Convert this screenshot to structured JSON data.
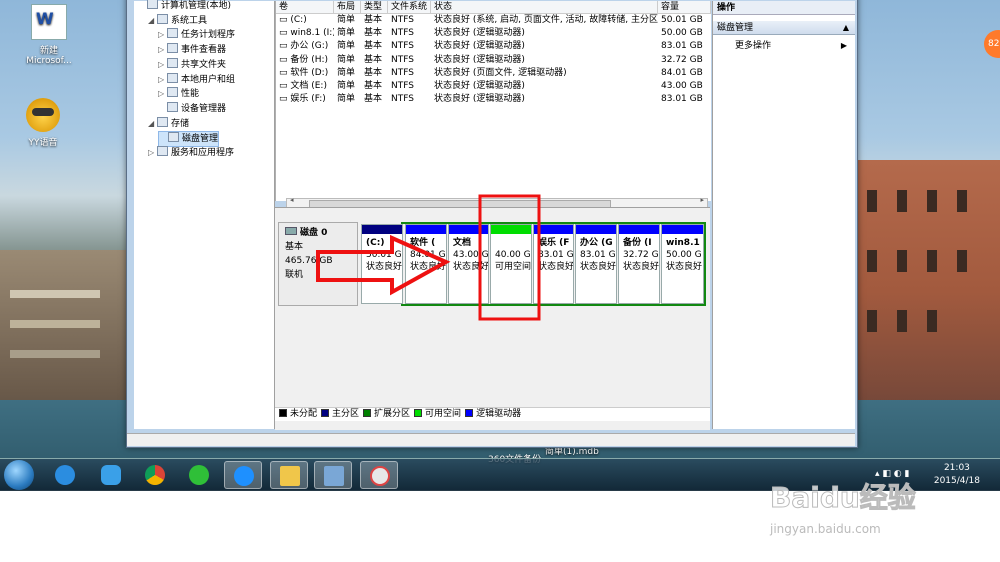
{
  "desktop": {
    "icons": [
      {
        "label": "新建\nMicrosof...",
        "icon": "word-document-icon"
      },
      {
        "label": "YY语音",
        "icon": "yy-voice-icon"
      }
    ],
    "badge": "82"
  },
  "tree": {
    "items": [
      {
        "label": "计算机管理(本地)",
        "level": 0,
        "expander": ""
      },
      {
        "label": "系统工具",
        "level": 1,
        "expander": "◢"
      },
      {
        "label": "任务计划程序",
        "level": 2,
        "expander": "▷"
      },
      {
        "label": "事件查看器",
        "level": 2,
        "expander": "▷"
      },
      {
        "label": "共享文件夹",
        "level": 2,
        "expander": "▷"
      },
      {
        "label": "本地用户和组",
        "level": 2,
        "expander": "▷"
      },
      {
        "label": "性能",
        "level": 2,
        "expander": "▷"
      },
      {
        "label": "设备管理器",
        "level": 2,
        "expander": ""
      },
      {
        "label": "存储",
        "level": 1,
        "expander": "◢"
      },
      {
        "label": "磁盘管理",
        "level": 2,
        "expander": "",
        "selected": true
      },
      {
        "label": "服务和应用程序",
        "level": 1,
        "expander": "▷"
      }
    ]
  },
  "volumes": {
    "headers": [
      "卷",
      "布局",
      "类型",
      "文件系统",
      "状态",
      "容量"
    ],
    "rows": [
      [
        "(C:)",
        "简单",
        "基本",
        "NTFS",
        "状态良好 (系统, 启动, 页面文件, 活动, 故障转储, 主分区)",
        "50.01 GB"
      ],
      [
        "win8.1 (I:)",
        "简单",
        "基本",
        "NTFS",
        "状态良好 (逻辑驱动器)",
        "50.00 GB"
      ],
      [
        "办公 (G:)",
        "简单",
        "基本",
        "NTFS",
        "状态良好 (逻辑驱动器)",
        "83.01 GB"
      ],
      [
        "备份 (H:)",
        "简单",
        "基本",
        "NTFS",
        "状态良好 (逻辑驱动器)",
        "32.72 GB"
      ],
      [
        "软件 (D:)",
        "简单",
        "基本",
        "NTFS",
        "状态良好 (页面文件, 逻辑驱动器)",
        "84.01 GB"
      ],
      [
        "文档 (E:)",
        "简单",
        "基本",
        "NTFS",
        "状态良好 (逻辑驱动器)",
        "43.00 GB"
      ],
      [
        "娱乐 (F:)",
        "简单",
        "基本",
        "NTFS",
        "状态良好 (逻辑驱动器)",
        "83.01 GB"
      ]
    ]
  },
  "disk": {
    "name": "磁盘 0",
    "type": "基本",
    "size": "465.76 GB",
    "status": "联机",
    "partitions": [
      {
        "name": "(C:)",
        "size": "50.01 G",
        "status": "状态良好",
        "bar": "#000080"
      },
      {
        "name": "软件 (",
        "size": "84.01 G",
        "status": "状态良好",
        "bar": "#0000ff"
      },
      {
        "name": "文档",
        "size": "43.00 G",
        "status": "状态良好",
        "bar": "#0000ff"
      },
      {
        "name": "",
        "size": "40.00 G",
        "status": "可用空间",
        "bar": "#00dd00"
      },
      {
        "name": "娱乐 (F",
        "size": "83.01 G",
        "status": "状态良好",
        "bar": "#0000ff"
      },
      {
        "name": "办公 (G",
        "size": "83.01 G",
        "status": "状态良好",
        "bar": "#0000ff"
      },
      {
        "name": "备份 (I",
        "size": "32.72 G",
        "status": "状态良好",
        "bar": "#0000ff"
      },
      {
        "name": "win8.1",
        "size": "50.00 G",
        "status": "状态良好",
        "bar": "#0000ff"
      }
    ]
  },
  "legend": [
    {
      "label": "未分配",
      "color": "#000000"
    },
    {
      "label": "主分区",
      "color": "#000080"
    },
    {
      "label": "扩展分区",
      "color": "#008000"
    },
    {
      "label": "可用空间",
      "color": "#00dd00"
    },
    {
      "label": "逻辑驱动器",
      "color": "#0000ff"
    }
  ],
  "actions": {
    "title": "操作",
    "section": "磁盘管理",
    "more": "更多操作"
  },
  "desktop_text": {
    "file": "360文件备份",
    "file2": "简单(1).mdb"
  },
  "clock": {
    "time": "21:03",
    "date": "2015/4/18"
  },
  "watermark": {
    "brand": "Baidu经验",
    "url": "jingyan.baidu.com"
  }
}
